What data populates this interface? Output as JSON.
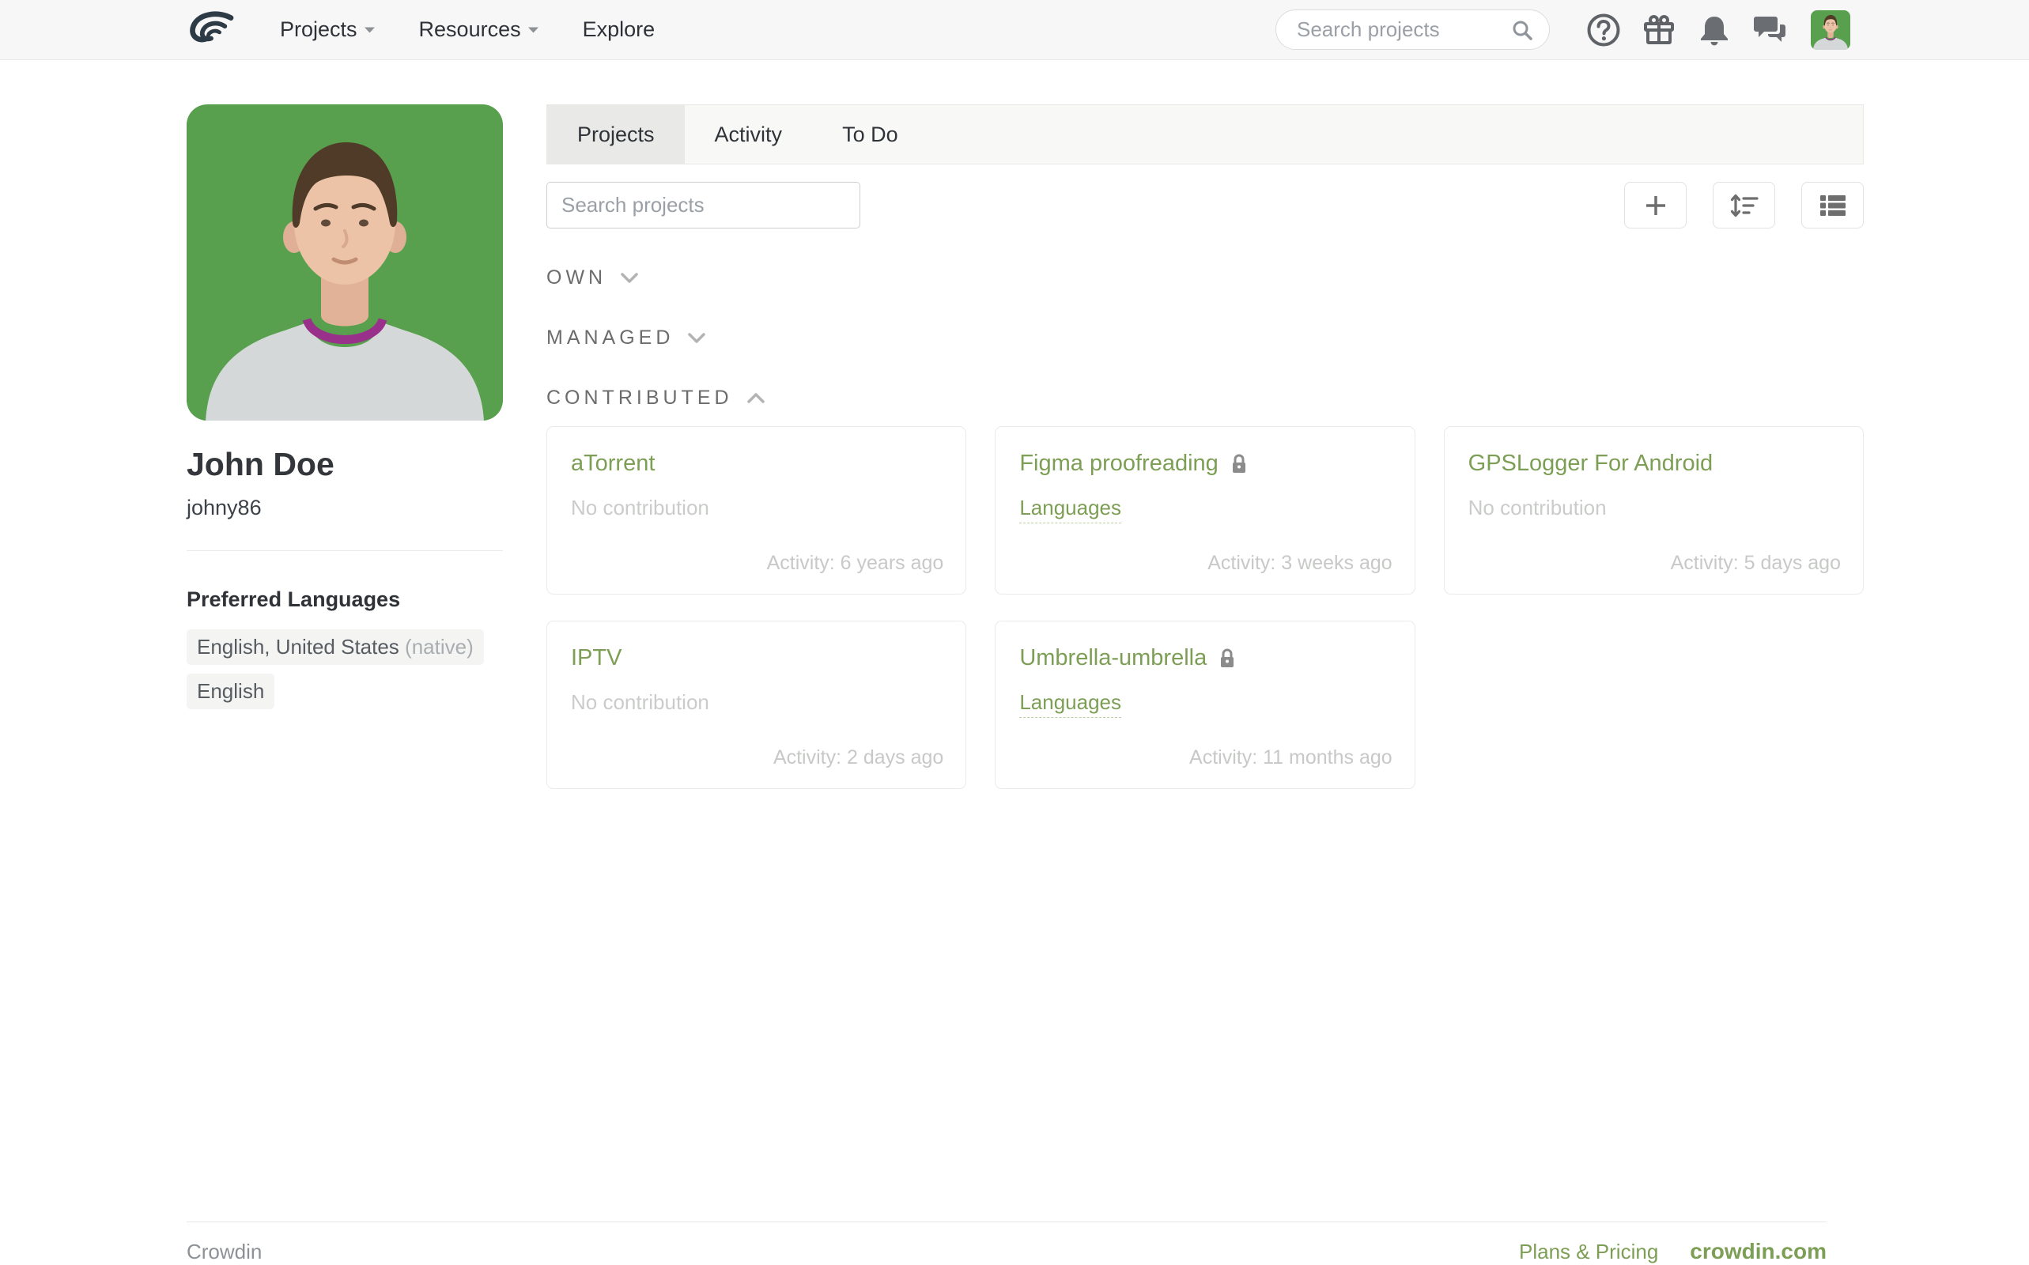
{
  "navbar": {
    "menu": [
      {
        "label": "Projects"
      },
      {
        "label": "Resources"
      },
      {
        "label": "Explore"
      }
    ],
    "search_placeholder": "Search projects",
    "icon_names": [
      "help-icon",
      "gift-icon",
      "notifications-icon",
      "messages-icon",
      "user-avatar"
    ]
  },
  "profile": {
    "name": "John Doe",
    "username": "johny86",
    "languages_title": "Preferred Languages",
    "languages": [
      {
        "name": "English, United States",
        "note": "(native)"
      },
      {
        "name": "English",
        "note": ""
      }
    ]
  },
  "tabs": [
    {
      "label": "Projects",
      "active": true
    },
    {
      "label": "Activity",
      "active": false
    },
    {
      "label": "To Do",
      "active": false
    }
  ],
  "toolbar": {
    "search_placeholder": "Search projects",
    "buttons": [
      "add-project",
      "sort",
      "list-view"
    ]
  },
  "sections": [
    {
      "label": "OWN",
      "expanded": false
    },
    {
      "label": "MANAGED",
      "expanded": false
    },
    {
      "label": "CONTRIBUTED",
      "expanded": true
    }
  ],
  "projects": [
    {
      "title": "aTorrent",
      "private": false,
      "contribution": "No contribution",
      "activity": "Activity: 6 years ago"
    },
    {
      "title": "Figma proofreading",
      "private": true,
      "languages_link": "Languages",
      "activity": "Activity: 3 weeks ago"
    },
    {
      "title": "GPSLogger For Android",
      "private": false,
      "contribution": "No contribution",
      "activity": "Activity: 5 days ago"
    },
    {
      "title": "IPTV",
      "private": false,
      "contribution": "No contribution",
      "activity": "Activity: 2 days ago"
    },
    {
      "title": "Umbrella-umbrella",
      "private": true,
      "languages_link": "Languages",
      "activity": "Activity: 11 months ago"
    }
  ],
  "footer": {
    "brand_left": "Crowdin",
    "plans_link": "Plans & Pricing",
    "site_link": "crowdin.com"
  },
  "colors": {
    "accent_green": "#7d9e55",
    "profile_bg_green": "#58a04e",
    "navbar_bg": "#f7f7f7",
    "active_tab_bg": "#e9e9e7"
  }
}
